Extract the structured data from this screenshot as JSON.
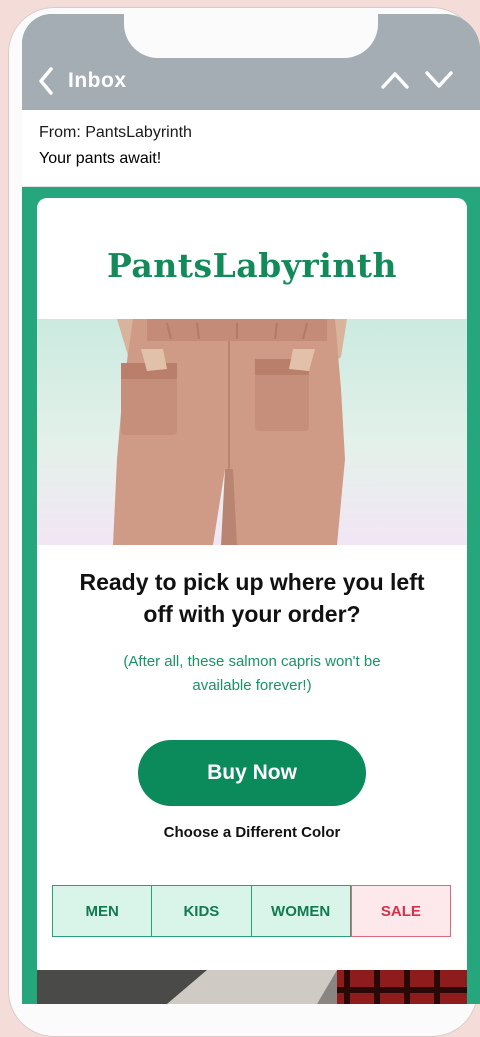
{
  "nav": {
    "back_label": "Inbox",
    "icons": {
      "back": "chevron-left-icon",
      "up": "chevron-up-icon",
      "down": "chevron-down-icon"
    }
  },
  "email": {
    "from": "From: PantsLabyrinth",
    "subject": "Your pants await!"
  },
  "brand": {
    "logo": "PantsLabyrinth",
    "color": "#138a59"
  },
  "content": {
    "headline": "Ready to pick up where you left off with your order?",
    "subtext": "(After all, these salmon capris won't be available forever!)",
    "buy_label": "Buy Now",
    "alt_link": "Choose a Different Color"
  },
  "categories": [
    {
      "label": "MEN"
    },
    {
      "label": "KIDS"
    },
    {
      "label": "WOMEN"
    },
    {
      "label": "SALE"
    }
  ],
  "colors": {
    "accent": "#26a67c",
    "button": "#0b8a5b",
    "sale": "#d3334a",
    "nav_bar": "#a4adb3"
  }
}
